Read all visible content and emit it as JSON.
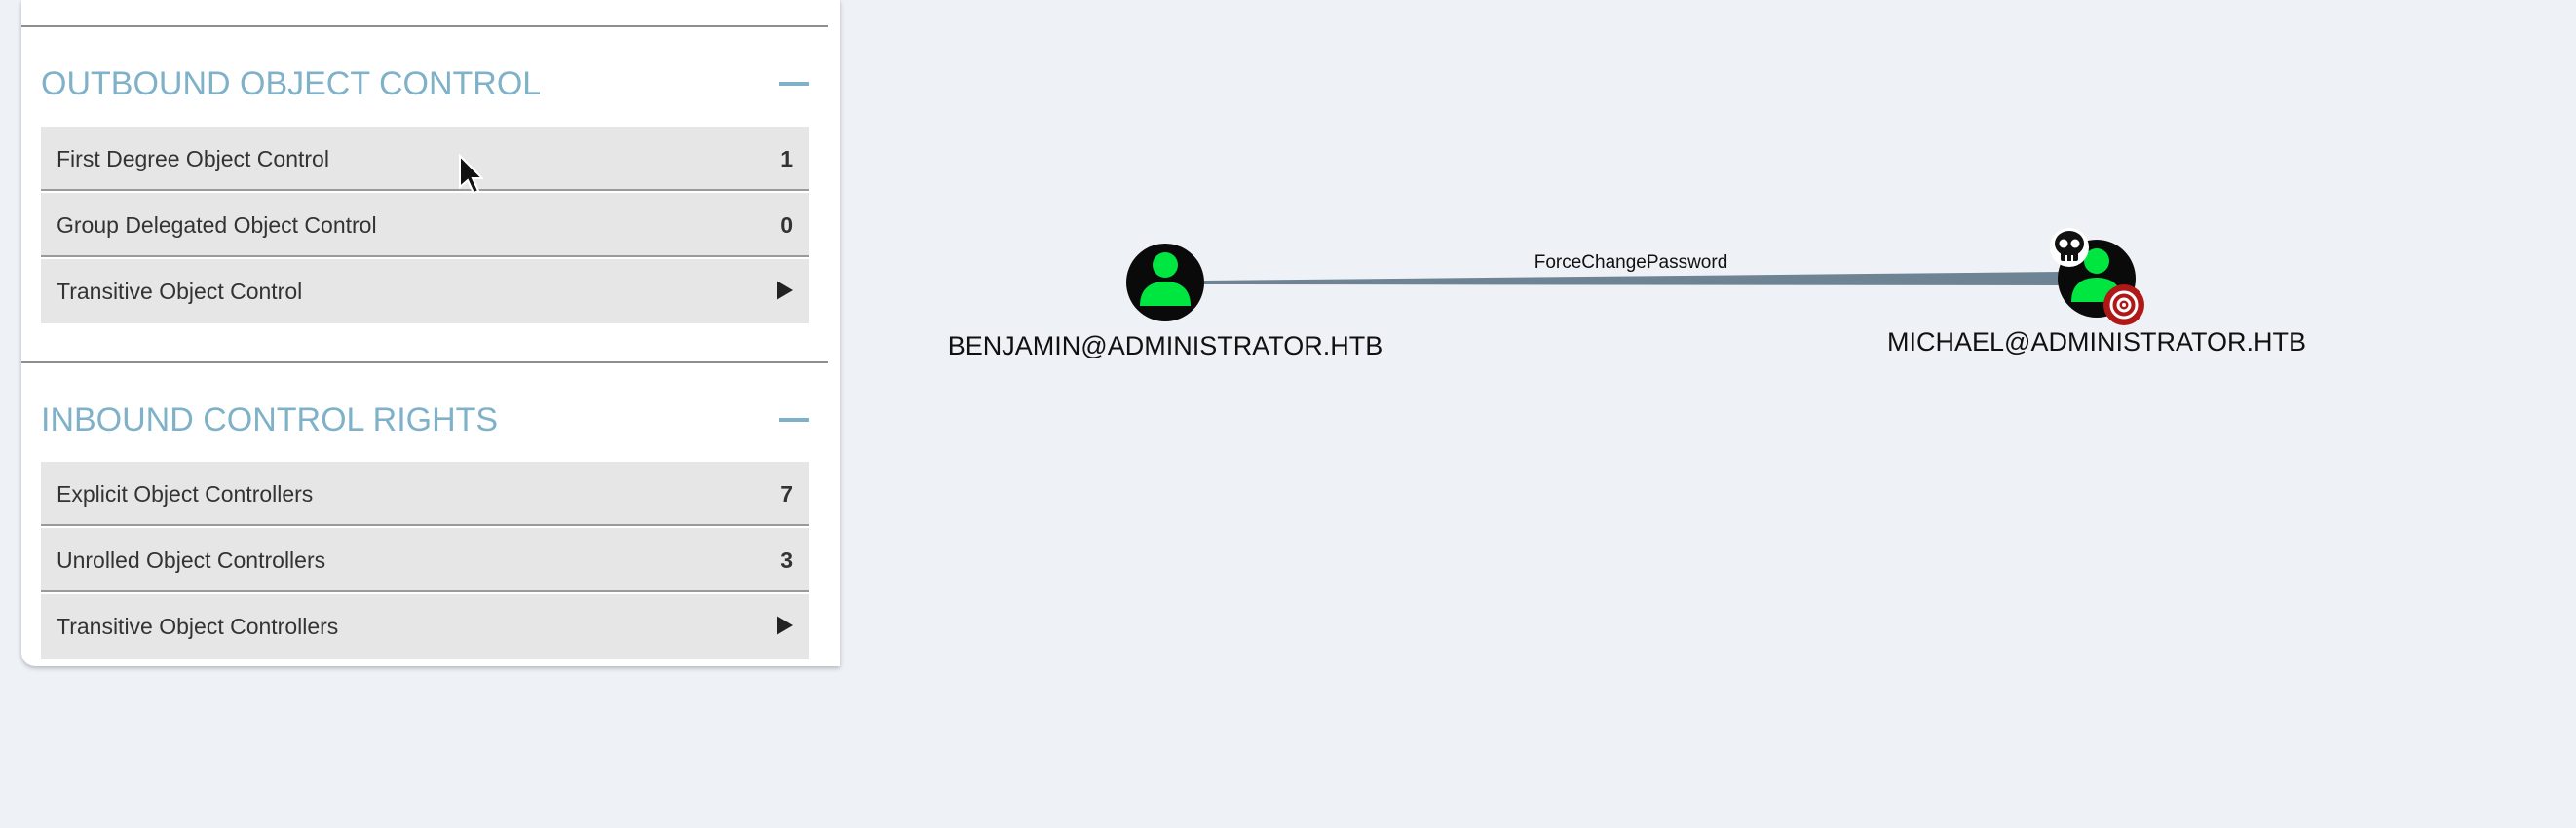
{
  "panel": {
    "outbound": {
      "title": "OUTBOUND OBJECT CONTROL",
      "rows": [
        {
          "label": "First Degree Object Control",
          "count": "1"
        },
        {
          "label": "Group Delegated Object Control",
          "count": "0"
        },
        {
          "label": "Transitive Object Control",
          "icon": "play-arrow-icon"
        }
      ]
    },
    "inbound": {
      "title": "INBOUND CONTROL RIGHTS",
      "rows": [
        {
          "label": "Explicit Object Controllers",
          "count": "7"
        },
        {
          "label": "Unrolled Object Controllers",
          "count": "3"
        },
        {
          "label": "Transitive Object Controllers",
          "icon": "play-arrow-icon"
        }
      ]
    },
    "colors": {
      "section_title": "#7fb1c9",
      "row_bg": "#e6e6e6",
      "scrollbar": "#8ac5cc"
    }
  },
  "graph": {
    "nodes": {
      "source": {
        "label": "BENJAMIN@ADMINISTRATOR.HTB",
        "icon": "user-icon"
      },
      "target": {
        "label": "MICHAEL@ADMINISTRATOR.HTB",
        "icon": "user-icon",
        "badges": [
          "skull-icon",
          "target-icon"
        ]
      }
    },
    "edge": {
      "label": "ForceChangePassword"
    },
    "colors": {
      "background": "#eef1f6",
      "node_fill": "#0a0a0a",
      "user_glyph": "#00e640",
      "edge": "#6e8393",
      "target_badge": "#b01818"
    }
  }
}
